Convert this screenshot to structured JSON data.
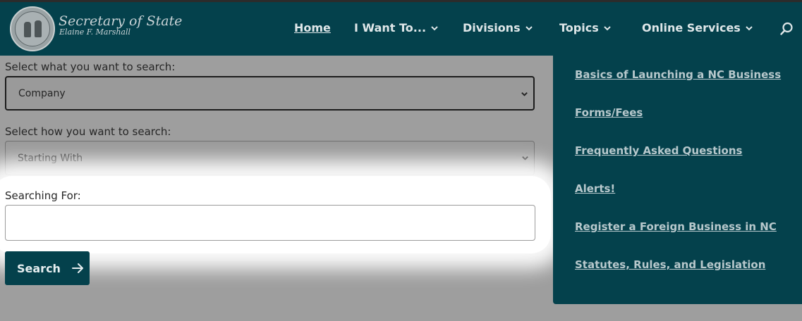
{
  "header": {
    "title": "Secretary of State",
    "subtitle": "Elaine F. Marshall",
    "nav": [
      {
        "label": "Home"
      },
      {
        "label": "I Want To..."
      },
      {
        "label": "Divisions"
      },
      {
        "label": "Topics"
      },
      {
        "label": "Online Services"
      }
    ]
  },
  "form": {
    "what_label": "Select what you want to search:",
    "what_value": "Company",
    "how_label": "Select how you want to search:",
    "how_value": "Starting With",
    "for_label": "Searching For:",
    "for_value": "",
    "search_button": "Search"
  },
  "dropdown": {
    "links": [
      {
        "label": "Basics of Launching a NC Business"
      },
      {
        "label": "Forms/Fees"
      },
      {
        "label": "Frequently Asked Questions"
      },
      {
        "label": "Alerts!"
      },
      {
        "label": "Register a Foreign Business in NC"
      },
      {
        "label": "Statutes, Rules, and Legislation"
      }
    ]
  },
  "colors": {
    "header_bg": "#04414c",
    "page_overlay": "#9e9e9e",
    "link_text": "#b7c8cc"
  }
}
